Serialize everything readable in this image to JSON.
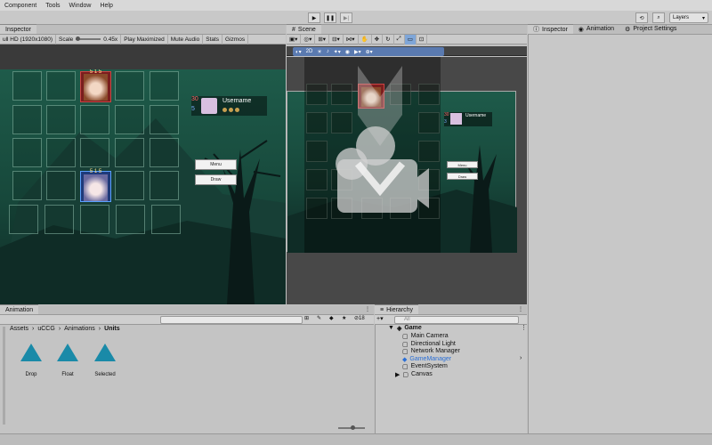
{
  "menubar": [
    "Component",
    "Tools",
    "Window",
    "Help"
  ],
  "toolbar": {
    "layers_label": "Layers",
    "play": "▶",
    "pause": "❚❚",
    "step": "▶|"
  },
  "game_panel": {
    "tab_label": "Inspector",
    "resolution": "ull HD (1920x1080)",
    "scale_label": "Scale",
    "scale_value": "0.45x",
    "play_mode": "Play Maximized",
    "mute": "Mute Audio",
    "stats": "Stats",
    "gizmos": "Gizmos",
    "username": "Username",
    "hp": "30",
    "mana": "5",
    "card_stats": "5 1 5",
    "menu_btn": "Menu",
    "draw_btn": "Draw"
  },
  "scene_panel": {
    "tab_label": "Scene",
    "username": "Username",
    "hp": "30",
    "mana": "3",
    "menu_btn": "Menu",
    "draw_btn": "Draw",
    "mode_2d": "2D"
  },
  "right_panel": {
    "tabs": [
      "Inspector",
      "Animation",
      "Project Settings"
    ]
  },
  "animation_panel": {
    "tab_label": "Animation",
    "breadcrumb": [
      "Assets",
      "uCCG",
      "Animations",
      "Units"
    ],
    "count": "18",
    "search_placeholder": "",
    "assets": [
      {
        "label": "Drop"
      },
      {
        "label": "Float"
      },
      {
        "label": "Selected"
      }
    ]
  },
  "hierarchy": {
    "tab_label": "Hierarchy",
    "search_placeholder": "All",
    "root": "Game",
    "items": [
      {
        "label": "Main Camera",
        "selected": false
      },
      {
        "label": "Directional Light",
        "selected": false
      },
      {
        "label": "Network Manager",
        "selected": false
      },
      {
        "label": "GameManager",
        "selected": true
      },
      {
        "label": "EventSystem",
        "selected": false
      },
      {
        "label": "Canvas",
        "selected": false
      }
    ]
  },
  "colors": {
    "accent": "#1a8aa8",
    "selection": "#2b6fd6",
    "game_bg": "#1d5a4a"
  }
}
